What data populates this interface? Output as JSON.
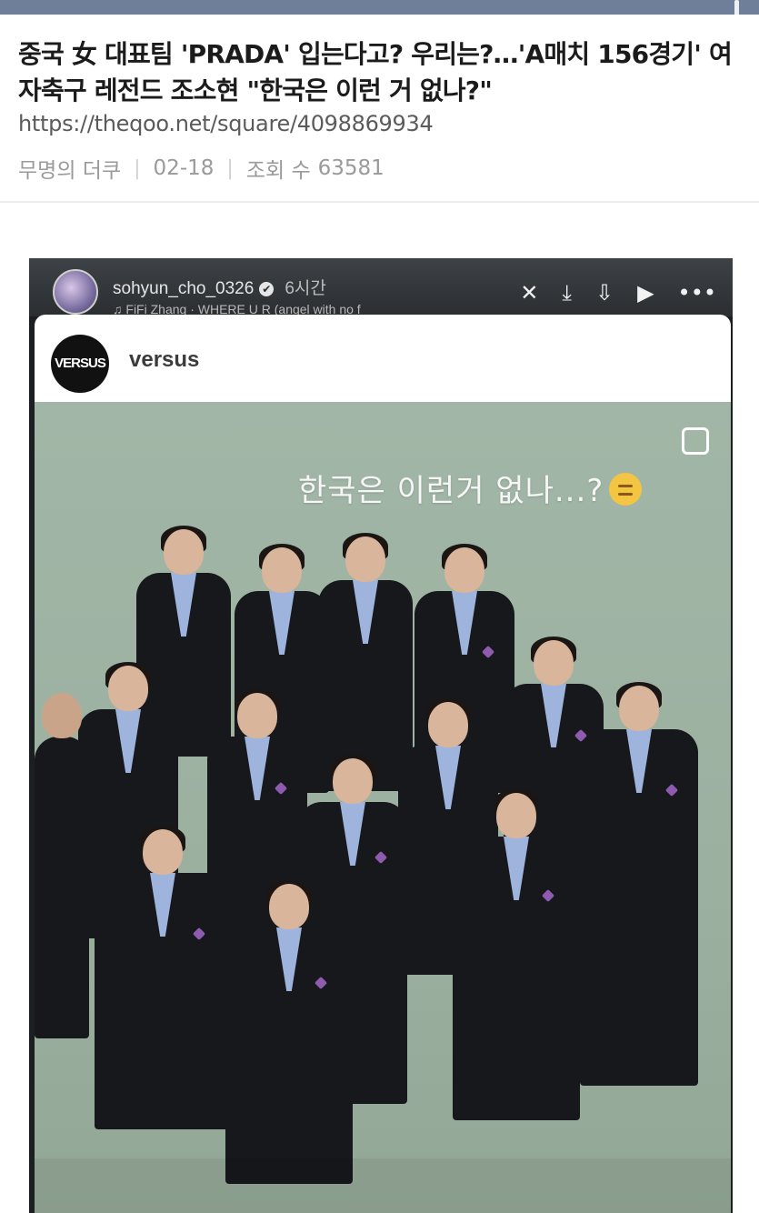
{
  "article": {
    "title": "중국 女 대표팀 'PRADA' 입는다고? 우리는?…'A매치 156경기' 여자축구 레전드 조소현 \"한국은 이런 거 없나?\"",
    "url": "https://theqoo.net/square/4098869934",
    "author": "무명의 더쿠",
    "date": "02-18",
    "views_label": "조회 수",
    "views": "63581"
  },
  "story": {
    "username": "sohyun_cho_0326",
    "verified_glyph": "✔",
    "time": "6시간",
    "music": "FiFi Zhang · WHERE U R (angel with no f",
    "icons": [
      "mute-icon",
      "download-icon",
      "save-icon",
      "play-icon",
      "more-icon"
    ]
  },
  "post": {
    "account_logo": "VERSUS",
    "account_name": "versus",
    "overlay_text": "한국은 이런거 없나...?"
  },
  "colors": {
    "topbar": "#6f7f9a",
    "photo_background": "#a2b6a7",
    "suit": "#16181b",
    "shirt": "#9fb4dd",
    "pin": "#8e5bb0"
  }
}
